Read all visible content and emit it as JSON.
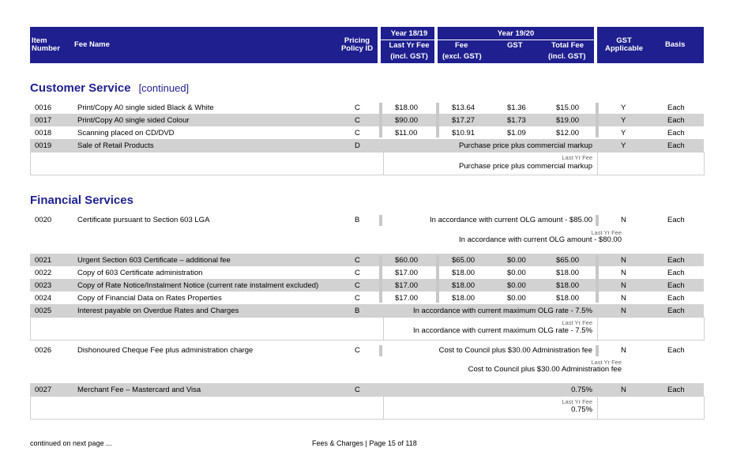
{
  "header": {
    "item_number": [
      "Item",
      "Number"
    ],
    "fee_name": "Fee Name",
    "pricing_policy": [
      "Pricing",
      "Policy ID"
    ],
    "year_prev": "Year 18/19",
    "last_yr_fee": "Last Yr Fee",
    "incl_gst": "(incl. GST)",
    "year_curr": "Year 19/20",
    "fee": "Fee",
    "excl_gst": "(excl. GST)",
    "gst": "GST",
    "total_fee": "Total Fee",
    "total_incl_gst": "(incl. GST)",
    "gst_applicable": [
      "GST",
      "Applicable"
    ],
    "basis": "Basis"
  },
  "sections": {
    "customer": {
      "title": "Customer Service",
      "continued": "[continued]",
      "rows": [
        {
          "num": "0016",
          "name": "Print/Copy A0 single sided Black & White",
          "pp": "C",
          "last": "$18.00",
          "fee": "$13.64",
          "gst": "$1.36",
          "total": "$15.00",
          "gst_app": "Y",
          "basis": "Each"
        },
        {
          "num": "0017",
          "name": "Print/Copy A0 single sided Colour",
          "pp": "C",
          "last": "$90.00",
          "fee": "$17.27",
          "gst": "$1.73",
          "total": "$19.00",
          "gst_app": "Y",
          "basis": "Each"
        },
        {
          "num": "0018",
          "name": "Scanning placed on CD/DVD",
          "pp": "C",
          "last": "$11.00",
          "fee": "$10.91",
          "gst": "$1.09",
          "total": "$12.00",
          "gst_app": "Y",
          "basis": "Each"
        },
        {
          "num": "0019",
          "name": "Sale of Retail Products",
          "pp": "D",
          "span": "Purchase price plus commercial markup",
          "gst_app": "Y",
          "basis": "Each",
          "ly_label": "Last Yr Fee",
          "ly_value": "Purchase price plus commercial markup"
        }
      ]
    },
    "financial": {
      "title": "Financial Services",
      "rows": [
        {
          "num": "0020",
          "name": "Certificate pursuant to Section 603 LGA",
          "pp": "B",
          "span": "In accordance with current OLG amount - $85.00",
          "gst_app": "N",
          "basis": "Each",
          "ly_label": "Last Yr Fee",
          "ly_value": "In accordance with current OLG amount - $80.00"
        },
        {
          "num": "0021",
          "name": "Urgent Section 603 Certificate – additional fee",
          "pp": "C",
          "last": "$60.00",
          "fee": "$65.00",
          "gst": "$0.00",
          "total": "$65.00",
          "gst_app": "N",
          "basis": "Each"
        },
        {
          "num": "0022",
          "name": "Copy of 603 Certificate administration",
          "pp": "C",
          "last": "$17.00",
          "fee": "$18.00",
          "gst": "$0.00",
          "total": "$18.00",
          "gst_app": "N",
          "basis": "Each"
        },
        {
          "num": "0023",
          "name": "Copy of Rate Notice/Instalment Notice (current rate instalment excluded)",
          "pp": "C",
          "last": "$17.00",
          "fee": "$18.00",
          "gst": "$0.00",
          "total": "$18.00",
          "gst_app": "N",
          "basis": "Each"
        },
        {
          "num": "0024",
          "name": "Copy of Financial Data on Rates Properties",
          "pp": "C",
          "last": "$17.00",
          "fee": "$18.00",
          "gst": "$0.00",
          "total": "$18.00",
          "gst_app": "N",
          "basis": "Each"
        },
        {
          "num": "0025",
          "name": "Interest payable on Overdue Rates and Charges",
          "pp": "B",
          "span": "In accordance with current maximum OLG rate - 7.5%",
          "gst_app": "N",
          "basis": "Each",
          "ly_label": "Last Yr Fee",
          "ly_value": "In accordance with current maximum OLG rate - 7.5%"
        },
        {
          "num": "0026",
          "name": "Dishonoured Cheque Fee plus administration charge",
          "pp": "C",
          "span": "Cost to Council plus $30.00 Administration fee",
          "gst_app": "N",
          "basis": "Each",
          "ly_label": "Last Yr Fee",
          "ly_value": "Cost to Council plus $30.00 Administration fee"
        },
        {
          "num": "0027",
          "name": "Merchant Fee – Mastercard and Visa",
          "pp": "C",
          "span": "0.75%",
          "gst_app": "N",
          "basis": "Each",
          "ly_label": "Last Yr Fee",
          "ly_value": "0.75%"
        }
      ]
    }
  },
  "footer": {
    "continued": "continued on next page ...",
    "page": "Fees & Charges | Page 15 of 118"
  }
}
